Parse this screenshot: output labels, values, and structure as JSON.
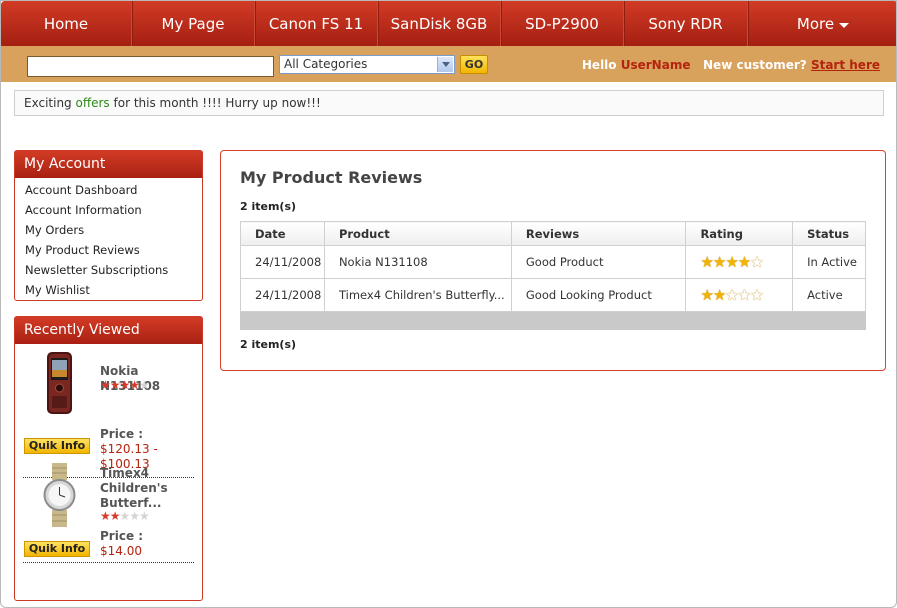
{
  "nav": {
    "items": [
      "Home",
      "My Page",
      "Canon FS 11",
      "SanDisk 8GB",
      "SD-P2900",
      "Sony RDR",
      "More"
    ]
  },
  "search": {
    "value": "",
    "category": "All Categories",
    "go_label": "GO"
  },
  "user": {
    "hello": "Hello",
    "username": "UserName",
    "new_customer": "New customer?",
    "start_here": "Start here"
  },
  "offers": {
    "prefix": "Exciting",
    "link": "offers",
    "suffix": "for this month !!!! Hurry up now!!!"
  },
  "account": {
    "title": "My Account",
    "items": [
      "Account Dashboard",
      "Account Information",
      "My Orders",
      "My Product Reviews",
      "Newsletter Subscriptions",
      "My Wishlist"
    ]
  },
  "recently_viewed": {
    "title": "Recently Viewed",
    "quik_label": "Quik Info",
    "price_label": "Price :",
    "items": [
      {
        "name": "Nokia N131108",
        "rating": 4,
        "price": "$120.13 -",
        "price2": "$100.13"
      },
      {
        "name_lines": [
          "Timex4",
          "Children's",
          "Butterf..."
        ],
        "rating": 2,
        "price": "$14.00"
      }
    ]
  },
  "reviews": {
    "title": "My Product Reviews",
    "count_top": "2 item(s)",
    "count_bottom": "2 item(s)",
    "columns": [
      "Date",
      "Product",
      "Reviews",
      "Rating",
      "Status"
    ],
    "rows": [
      {
        "date": "24/11/2008",
        "product": "Nokia N131108",
        "review": "Good Product",
        "rating": 4,
        "status": "In Active"
      },
      {
        "date": "24/11/2008",
        "product": "Timex4 Children's Butterfly...",
        "review": "Good Looking Product",
        "rating": 2,
        "status": "Active"
      }
    ]
  },
  "colors": {
    "brand_red": "#c22d1a",
    "search_bar": "#d8a15c",
    "accent_yellow": "#f2b400"
  }
}
